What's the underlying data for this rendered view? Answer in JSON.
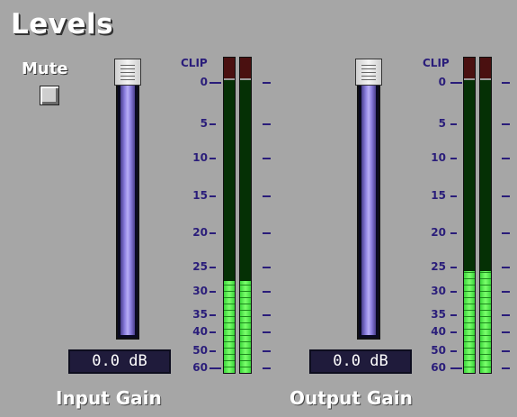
{
  "title": "Levels",
  "mute": {
    "label": "Mute",
    "checked": false
  },
  "scale": {
    "clip": "CLIP",
    "ticks": [
      "0",
      "5",
      "10",
      "15",
      "20",
      "25",
      "30",
      "35",
      "40",
      "50",
      "60"
    ]
  },
  "input": {
    "label": "Input Gain",
    "readout": "0.0 dB",
    "fader_level": 1.0,
    "meters": [
      0.29,
      0.29
    ]
  },
  "output": {
    "label": "Output Gain",
    "readout": "0.0 dB",
    "fader_level": 1.0,
    "meters": [
      0.32,
      0.32
    ]
  },
  "colors": {
    "background": "#a6a6a6",
    "scale_text": "#2a1d7a",
    "meter_bg": "#053005",
    "meter_level": "#5cf04a",
    "clip": "#4a1010",
    "fader": "#8c80e0"
  }
}
